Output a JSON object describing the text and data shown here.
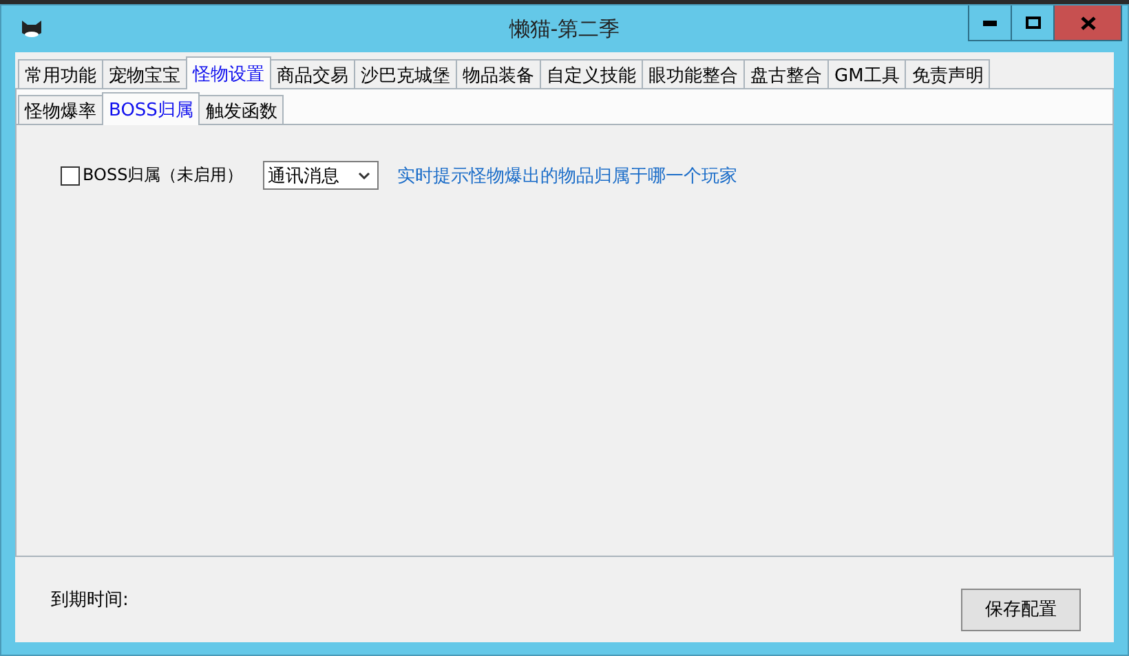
{
  "window": {
    "title": "懒猫-第二季"
  },
  "tabs": [
    {
      "label": "常用功能",
      "selected": false
    },
    {
      "label": "宠物宝宝",
      "selected": false
    },
    {
      "label": "怪物设置",
      "selected": true
    },
    {
      "label": "商品交易",
      "selected": false
    },
    {
      "label": "沙巴克城堡",
      "selected": false
    },
    {
      "label": "物品装备",
      "selected": false
    },
    {
      "label": "自定义技能",
      "selected": false
    },
    {
      "label": "眼功能整合",
      "selected": false
    },
    {
      "label": "盘古整合",
      "selected": false
    },
    {
      "label": "GM工具",
      "selected": false
    },
    {
      "label": "免责声明",
      "selected": false
    }
  ],
  "subtabs": [
    {
      "label": "怪物爆率",
      "selected": false
    },
    {
      "label": "BOSS归属",
      "selected": true
    },
    {
      "label": "触发函数",
      "selected": false
    }
  ],
  "option": {
    "label": "BOSS归属（未启用）",
    "checked": false,
    "dropdown": "通讯消息",
    "hint": "实时提示怪物爆出的物品归属于哪一个玩家"
  },
  "footer": {
    "expiry_label": "到期时间:",
    "save_button": "保存配置"
  }
}
